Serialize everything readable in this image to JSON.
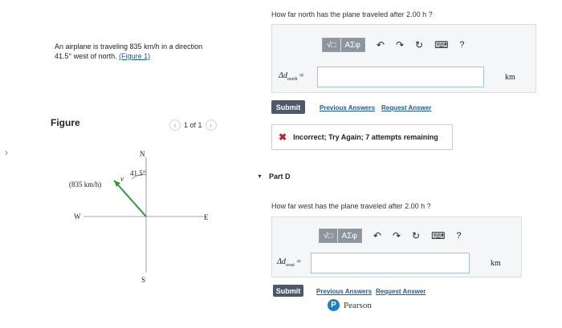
{
  "sidebar": {
    "arrow": "›"
  },
  "problem": {
    "text_prefix": "An airplane is traveling 835 km/h in a direction",
    "text_line2": "41.5° west of north. ",
    "figure_link": "(Figure 1)"
  },
  "figure": {
    "label": "Figure",
    "pager_text": "1 of 1",
    "prev_icon": "chevron-left-icon",
    "next_icon": "chevron-right-icon",
    "compass": {
      "north": "N",
      "south": "S",
      "east": "E",
      "west": "W"
    },
    "speed_label": "(835 km/h)",
    "angle_label": "41.5°",
    "vector_symbol": "v"
  },
  "part_c": {
    "question": "How far north has the plane traveled after 2.00 h ?",
    "toolbar": {
      "radical_label": "√□",
      "greek_label": "ΑΣφ",
      "help_label": "?"
    },
    "answer_label": "Δd",
    "answer_subscript": "north",
    "answer_eq": "=",
    "answer_value": "",
    "unit": "km",
    "submit_label": "Submit",
    "previous_answers_label": "Previous Answers",
    "request_answer_label": "Request Answer",
    "feedback": "Incorrect; Try Again; 7 attempts remaining"
  },
  "part_d": {
    "title": "Part D",
    "question": "How far west has the plane traveled after 2.00 h ?",
    "toolbar": {
      "radical_label": "√□",
      "greek_label": "ΑΣφ",
      "help_label": "?"
    },
    "answer_label": "Δd",
    "answer_subscript": "west",
    "answer_eq": "=",
    "answer_value": "",
    "unit": "km",
    "submit_label": "Submit",
    "previous_answers_label": "Previous Answers",
    "request_answer_label": "Request Answer"
  },
  "footer": {
    "brand": "Pearson",
    "brand_initial": "P"
  },
  "colors": {
    "accent_link": "#1a5a9c",
    "submit_bg": "#4b5a6b",
    "error": "#c0212a",
    "vector": "#2e9a3c",
    "pearson_blue": "#1f7ec1"
  }
}
